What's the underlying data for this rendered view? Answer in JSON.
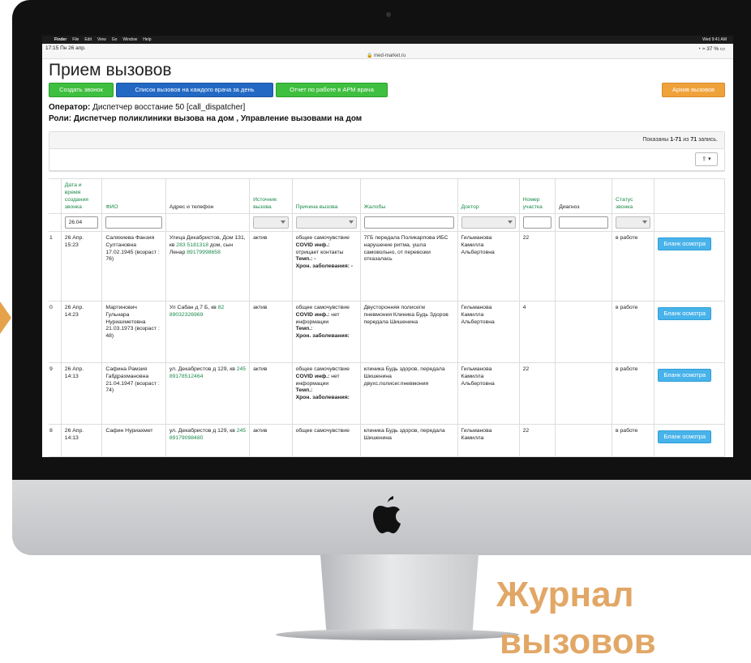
{
  "browser": {
    "menu_items": [
      "Finder",
      "File",
      "Edit",
      "View",
      "Go",
      "Window",
      "Help"
    ],
    "menu_right": "Wed 9:41 AM",
    "time": "17:15  Пн 26 апр.",
    "url": "med-market.ru",
    "battery": "37 %"
  },
  "page": {
    "title": "Прием вызовов",
    "buttons": {
      "create_call": "Создать звонок",
      "calls_per_doctor": "Список вызовов на каждого врача за день",
      "report": "Отчет по работе в АРМ врача",
      "archive": "Архив вызовов"
    },
    "operator_label": "Оператор:",
    "operator_value": "Диспетчер восстание 50 [call_dispatcher]",
    "roles_label": "Роли:",
    "roles_value": "Диспетчер поликлиники вызова на дом , Управление вызовами на дом"
  },
  "panel": {
    "shown_prefix": "Показаны",
    "shown_range": "1-71",
    "shown_middle": "из",
    "shown_total": "71",
    "shown_suffix": "запись.",
    "export_label": "⇪ ▾"
  },
  "table": {
    "headers": {
      "datetime": "Дата и время создания звонка",
      "fio": "ФИО",
      "address": "Адрес и телефон",
      "source": "Источник вызова",
      "reason": "Причина вызова",
      "complaints": "Жалобы",
      "doctor": "Доктор",
      "section": "Номер участка",
      "diagnosis": "Диагноз",
      "status": "Статус звонка"
    },
    "filter_date": "26.04",
    "action_label": "Бланк осмотра",
    "rows": [
      {
        "num": "1",
        "datetime": "26 Апр. 15:23",
        "fio": "Саляхиева Фанзия Султановна 17.02.1945 (возраст : 76)",
        "address": "Улица Декабристов, Дом 131, кв",
        "phone1": "283 5181318",
        "address_tail": "дом, сын Ленар",
        "phone2": "89179998658",
        "source": "актив",
        "reason_a": "общее самочувствие",
        "reason_b": "COVID инф.:",
        "reason_c": "отрицает контакты",
        "reason_d": "Темп.: -",
        "reason_e": "Хрон. заболевания: -",
        "complaints": "7ГБ передала Поликарпова ИБС нарушение ритма, ушла самовольно, от перевозки отказалась",
        "doctor": "Гильманова Камилла Альбертовна",
        "section": "22",
        "diagnosis": "",
        "status": "в работе"
      },
      {
        "num": "0",
        "datetime": "26 Апр. 14:23",
        "fio": "Мартинович Гульнара Нуриахметовна 21.03.1973 (возраст : 48)",
        "address": "Ул Сабан д 7 Б, кв",
        "phone1": "82 89032326969",
        "address_tail": "",
        "phone2": "",
        "source": "актив",
        "reason_a": "общее самочувствие",
        "reason_b": "COVID инф.:",
        "reason_c": "нет информации",
        "reason_d": "Темп.:",
        "reason_e": "Хрон. заболевания:",
        "complaints": "Двусторонняя полисегм пневмония Клиника Будь Здоров передала Шишенина",
        "doctor": "Гильманова Камилла Альбертовна",
        "section": "4",
        "diagnosis": "",
        "status": "в работе"
      },
      {
        "num": "9",
        "datetime": "26 Апр. 14:13",
        "fio": "Сафина Рамзия Габдрахмановна 21.04.1947 (возраст : 74)",
        "address": "ул. Декабристов д 129, кв",
        "phone1": "245 89178512464",
        "address_tail": "",
        "phone2": "",
        "source": "актив",
        "reason_a": "общее самочувствие",
        "reason_b": "COVID инф.:",
        "reason_c": "нет информации",
        "reason_d": "Темп.:",
        "reason_e": "Хрон. заболевания:",
        "complaints": "клиника Будь здоров, передала Шишенина двухс.полисег.пневмония",
        "doctor": "Гильманова Камилла Альбертовна",
        "section": "22",
        "diagnosis": "",
        "status": "в работе"
      },
      {
        "num": "8",
        "datetime": "26 Апр. 14:13",
        "fio": "Сафин Нуриахмет",
        "address": "ул. Декабристов д 129, кв",
        "phone1": "245 89179098480",
        "address_tail": "",
        "phone2": "",
        "source": "актив",
        "reason_a": "общее самочувствие",
        "reason_b": "",
        "reason_c": "",
        "reason_d": "",
        "reason_e": "",
        "complaints": "клиника Будь здоров, передала Шишенина",
        "doctor": "Гильманова Камилла",
        "section": "22",
        "diagnosis": "",
        "status": "в работе"
      }
    ]
  },
  "promo": {
    "line1": "Журнал",
    "line2": "вызовов"
  },
  "colors": {
    "green_button": "#3fbf3f",
    "blue_button": "#2369c4",
    "orange_button": "#f0a23a",
    "action_button": "#48b3ea",
    "promo_text": "#e2a766"
  }
}
